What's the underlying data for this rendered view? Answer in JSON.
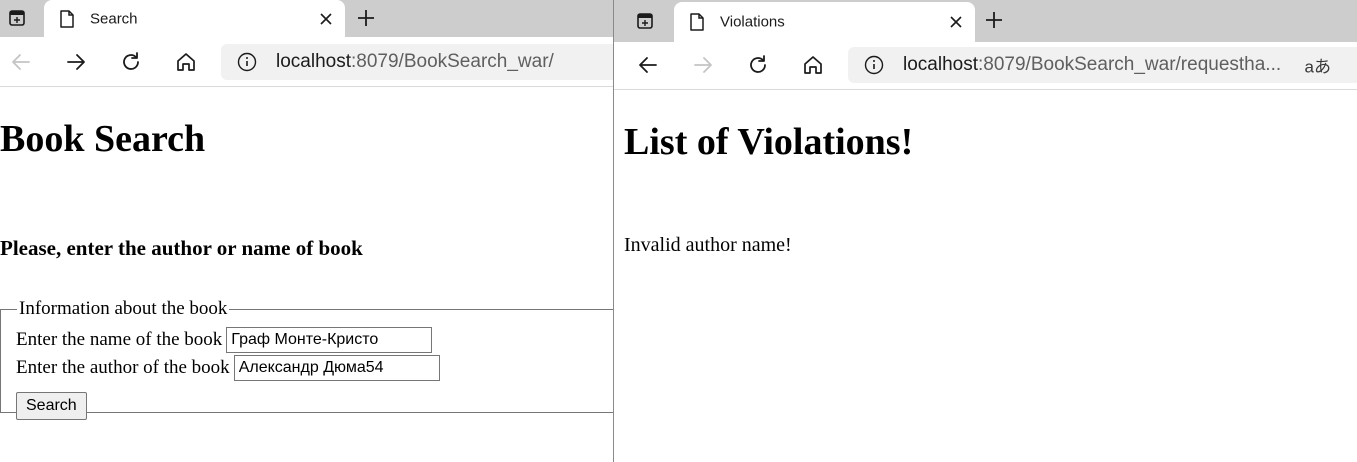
{
  "left_window": {
    "tab": {
      "title": "Search"
    },
    "address_bar": {
      "host": "localhost",
      "path": ":8079/BookSearch_war/"
    },
    "page": {
      "heading": "Book Search",
      "subheading": "Please, enter the author or name of book",
      "fieldset": {
        "legend": "Information about the book",
        "book_name": {
          "label": "Enter the name of the book",
          "value": "Граф Монте-Кристо"
        },
        "author": {
          "label": "Enter the author of the book",
          "value": "Александр Дюма54"
        },
        "submit_label": "Search"
      }
    }
  },
  "right_window": {
    "tab": {
      "title": "Violations"
    },
    "address_bar": {
      "host": "localhost",
      "path": ":8079/BookSearch_war/requestha..."
    },
    "read_aloud": "aあ",
    "page": {
      "heading": "List of Violations!",
      "message": "Invalid author name!"
    }
  },
  "icons": {
    "tab_actions": "tab-actions-icon",
    "page": "page-icon",
    "close": "close-icon",
    "new_tab": "plus-icon",
    "back": "back-arrow-icon",
    "forward": "forward-arrow-icon",
    "refresh": "refresh-icon",
    "home": "home-icon",
    "site_info": "info-icon"
  },
  "colors": {
    "tab_strip": "#cdcdcd",
    "omnibox": "#f1f1f1",
    "text": "#000000",
    "disabled_icon": "#c4c4c4"
  }
}
